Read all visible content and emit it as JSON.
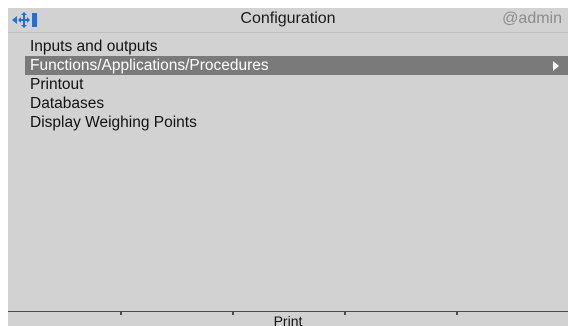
{
  "header": {
    "title": "Configuration",
    "user": "@admin",
    "nav_icon": "navigation-arrows-icon"
  },
  "menu": {
    "items": [
      {
        "label": "Inputs and outputs",
        "selected": false
      },
      {
        "label": "Functions/Applications/Procedures",
        "selected": true,
        "has_submenu": true
      },
      {
        "label": "Printout",
        "selected": false
      },
      {
        "label": "Databases",
        "selected": false
      },
      {
        "label": "Display Weighing Points",
        "selected": false
      }
    ]
  },
  "softkeys": {
    "items": [
      "",
      "",
      "Print",
      "",
      ""
    ]
  },
  "colors": {
    "background": "#d2d2d2",
    "selection": "#7a7a7a",
    "user_text": "#8c8c8c",
    "nav_icon_blue": "#1f6fe0"
  }
}
